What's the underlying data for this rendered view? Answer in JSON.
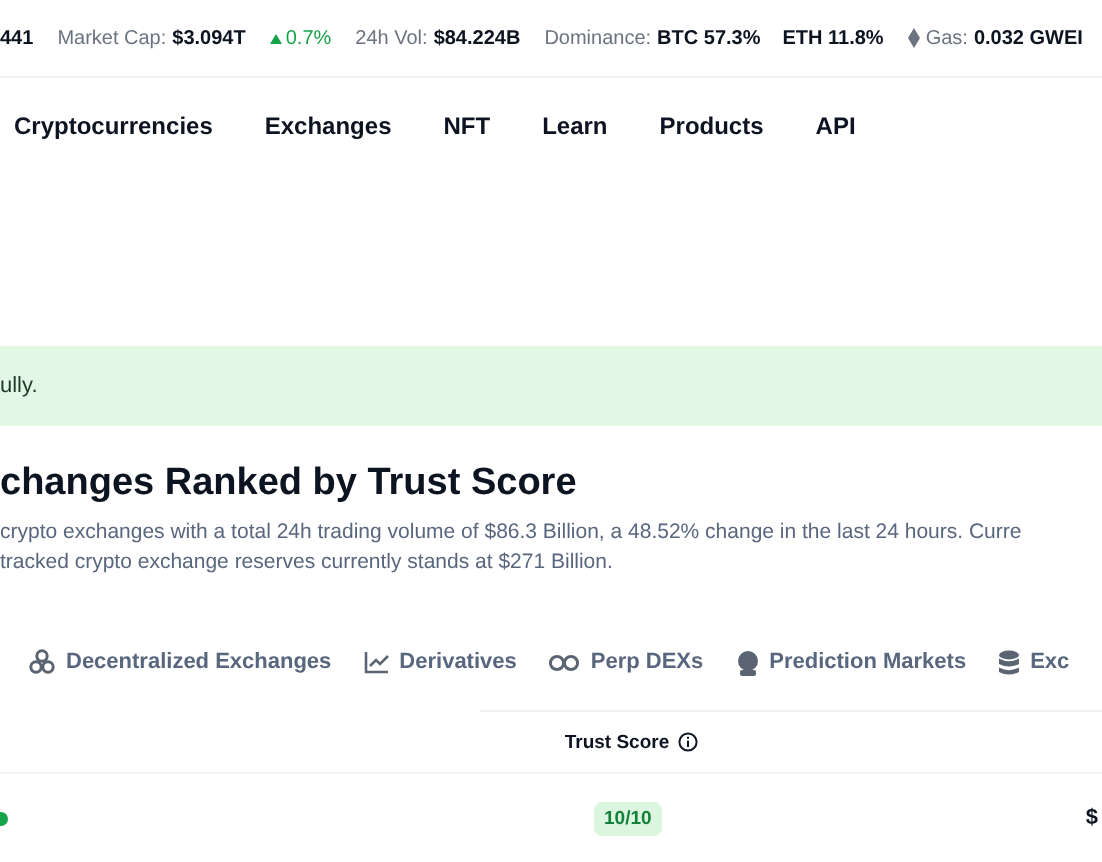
{
  "ticker": [
    {
      "value": "441"
    },
    {
      "label": "Market Cap:",
      "value": "$3.094T",
      "change": "0.7%"
    },
    {
      "label": "24h Vol:",
      "value": "$84.224B"
    },
    {
      "label": "Dominance:",
      "value": "BTC 57.3%",
      "extra": "ETH 11.8%"
    },
    {
      "label": "Gas:",
      "value": "0.032 GWEI",
      "kind": "gas"
    }
  ],
  "nav": [
    "Cryptocurrencies",
    "Exchanges",
    "NFT",
    "Learn",
    "Products",
    "API"
  ],
  "alert": {
    "text": "ully."
  },
  "heading": "changes Ranked by Trust Score",
  "description": [
    "crypto exchanges with a total 24h trading volume of $86.3 Billion, a 48.52% change in the last 24 hours. Curre",
    "tracked crypto exchange reserves currently stands at $271 Billion."
  ],
  "tabs": [
    {
      "label": "Decentralized Exchanges",
      "kind": "dex",
      "selected": false
    },
    {
      "label": "Derivatives",
      "kind": "chart",
      "selected": false
    },
    {
      "label": "Perp DEXs",
      "kind": "infinity",
      "selected": false
    },
    {
      "label": "Prediction Markets",
      "kind": "ball",
      "selected": false
    },
    {
      "label": "Exc",
      "kind": "database",
      "selected": false
    }
  ],
  "table": {
    "columns": [
      "Trust Score"
    ],
    "rows": [
      {
        "trust_score": "10/10",
        "column_3": "$"
      }
    ]
  }
}
